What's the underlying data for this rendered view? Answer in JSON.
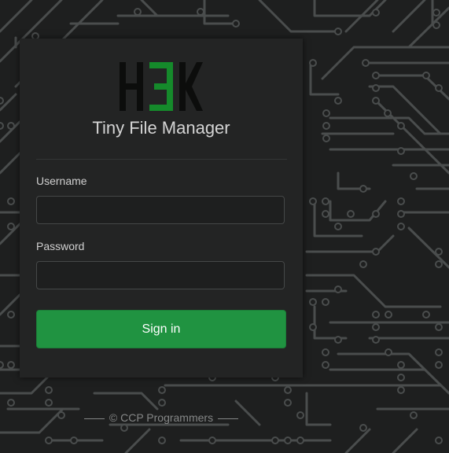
{
  "logo": {
    "text": "H3K",
    "colors": {
      "letters": "#0c0d0c",
      "accent": "#158a2b"
    }
  },
  "app": {
    "title": "Tiny File Manager"
  },
  "form": {
    "username_label": "Username",
    "username_value": "",
    "password_label": "Password",
    "password_value": "",
    "submit_label": "Sign in"
  },
  "footer": {
    "text": "© CCP Programmers"
  },
  "theme": {
    "background": "#1e1f1f",
    "circuit_color": "#4a4d4d",
    "card": "#232424",
    "button": "#209341"
  }
}
